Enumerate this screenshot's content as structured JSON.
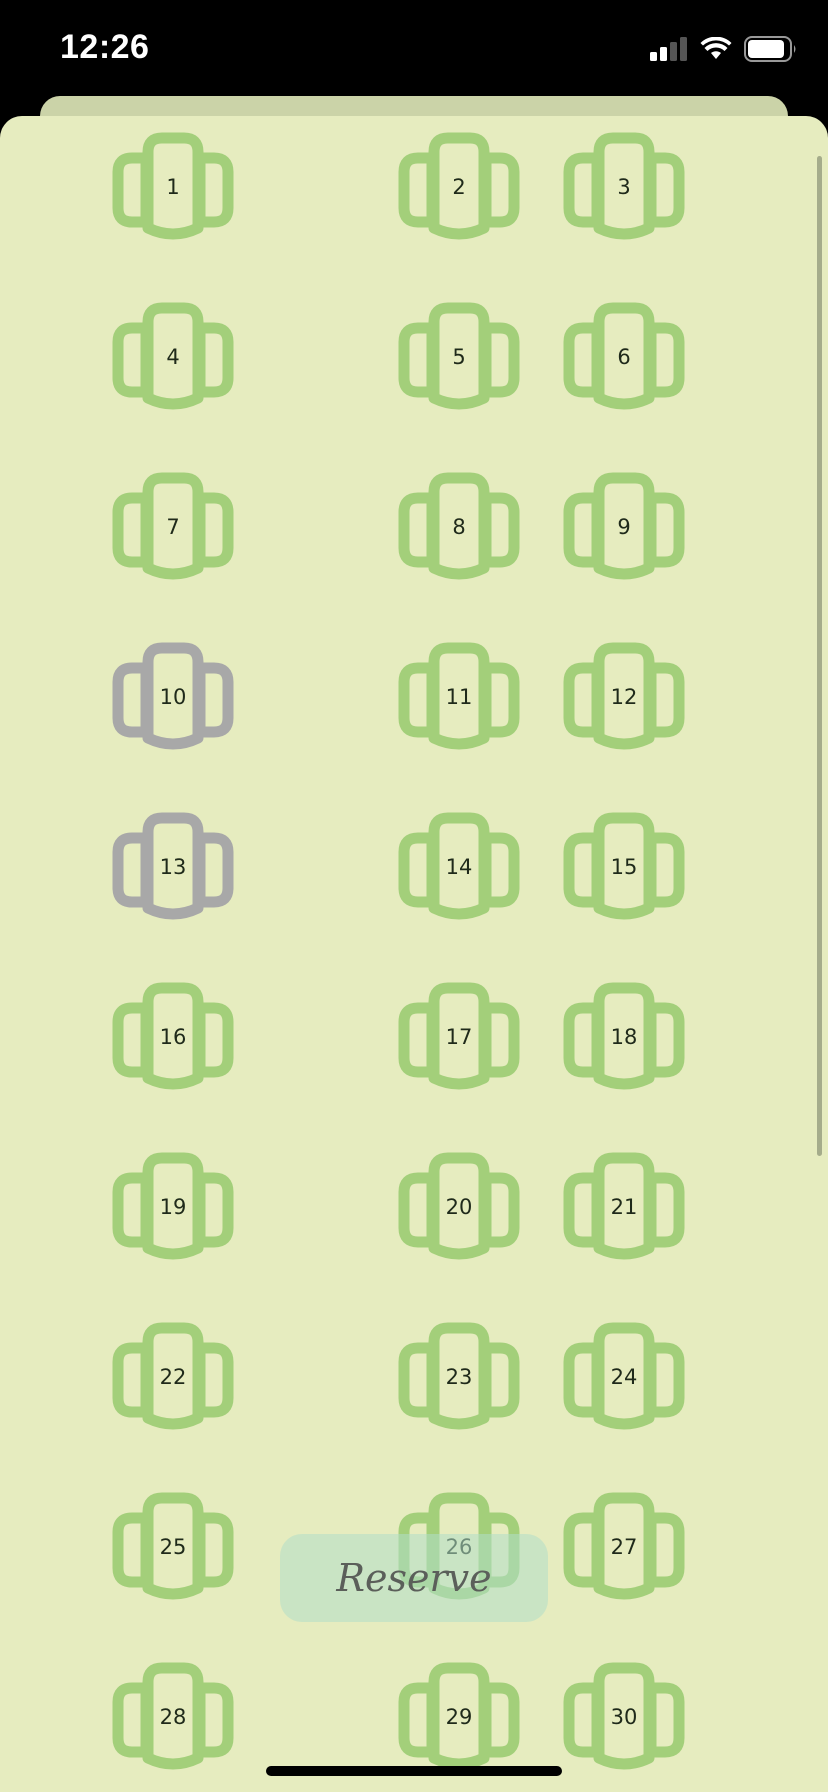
{
  "status_bar": {
    "time": "12:26",
    "icons": [
      "signal-icon",
      "wifi-icon",
      "battery-icon"
    ]
  },
  "colors": {
    "available": "#a3cf7a",
    "unavailable": "#a8a8a8",
    "background": "#e6ecbf"
  },
  "seats": [
    {
      "label": "1",
      "status": "available"
    },
    {
      "label": "2",
      "status": "available"
    },
    {
      "label": "3",
      "status": "available"
    },
    {
      "label": "4",
      "status": "available"
    },
    {
      "label": "5",
      "status": "available"
    },
    {
      "label": "6",
      "status": "available"
    },
    {
      "label": "7",
      "status": "available"
    },
    {
      "label": "8",
      "status": "available"
    },
    {
      "label": "9",
      "status": "available"
    },
    {
      "label": "10",
      "status": "unavailable"
    },
    {
      "label": "11",
      "status": "available"
    },
    {
      "label": "12",
      "status": "available"
    },
    {
      "label": "13",
      "status": "unavailable"
    },
    {
      "label": "14",
      "status": "available"
    },
    {
      "label": "15",
      "status": "available"
    },
    {
      "label": "16",
      "status": "available"
    },
    {
      "label": "17",
      "status": "available"
    },
    {
      "label": "18",
      "status": "available"
    },
    {
      "label": "19",
      "status": "available"
    },
    {
      "label": "20",
      "status": "available"
    },
    {
      "label": "21",
      "status": "available"
    },
    {
      "label": "22",
      "status": "available"
    },
    {
      "label": "23",
      "status": "available"
    },
    {
      "label": "24",
      "status": "available"
    },
    {
      "label": "25",
      "status": "available"
    },
    {
      "label": "26",
      "status": "available"
    },
    {
      "label": "27",
      "status": "available"
    },
    {
      "label": "28",
      "status": "available"
    },
    {
      "label": "29",
      "status": "available"
    },
    {
      "label": "30",
      "status": "available"
    }
  ],
  "reserve_button": {
    "label": "Reserve"
  }
}
